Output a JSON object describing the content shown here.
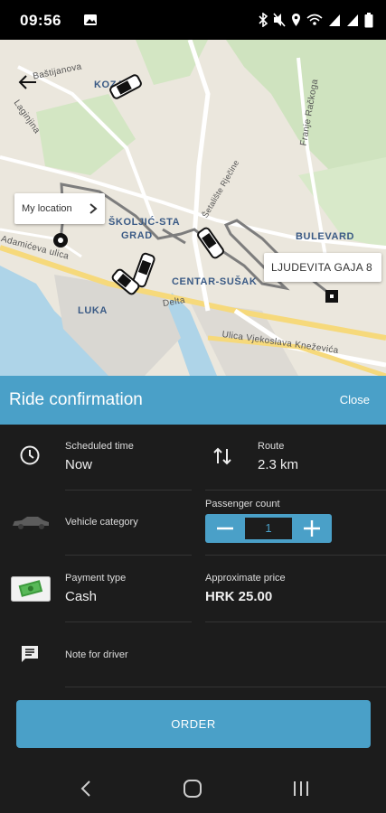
{
  "status_bar": {
    "time": "09:56",
    "icons": [
      "gallery-icon",
      "bluetooth-icon",
      "mute-icon",
      "location-icon",
      "wifi-call-icon",
      "signal-icon",
      "signal-icon",
      "battery-icon"
    ]
  },
  "map": {
    "labels": {
      "bastijanova": "Baštijanova",
      "kozala": "KOZALA",
      "laginjina": "Laginjina",
      "franje": "Franje Račkoga",
      "skoljic": "ŠKOLJIĆ-STA",
      "grad": "GRAD",
      "bulevard": "BULEVARD",
      "adamiceva": "Adamićeva ulica",
      "centar": "CENTAR-SUŠAK",
      "luka": "LUKA",
      "delta": "Delta",
      "vjekoslava": "Ulica Vjekoslava Kneževića",
      "rjecine": "Šetalište Rječine"
    },
    "my_location_label": "My location",
    "destination_label": "LJUDEVITA GAJA 8"
  },
  "header": {
    "title": "Ride confirmation",
    "close_label": "Close"
  },
  "details": {
    "scheduled_time_label": "Scheduled time",
    "scheduled_time_value": "Now",
    "route_label": "Route",
    "route_value": "2.3 km",
    "vehicle_category_label": "Vehicle category",
    "passenger_count_label": "Passenger count",
    "passenger_count_value": "1",
    "payment_type_label": "Payment type",
    "payment_type_value": "Cash",
    "approx_price_label": "Approximate price",
    "approx_price_value": "HRK 25.00",
    "note_label": "Note for driver"
  },
  "order_button_label": "ORDER",
  "colors": {
    "accent": "#4aa0c8",
    "panel_bg": "#1c1c1c",
    "divider": "#333333"
  }
}
